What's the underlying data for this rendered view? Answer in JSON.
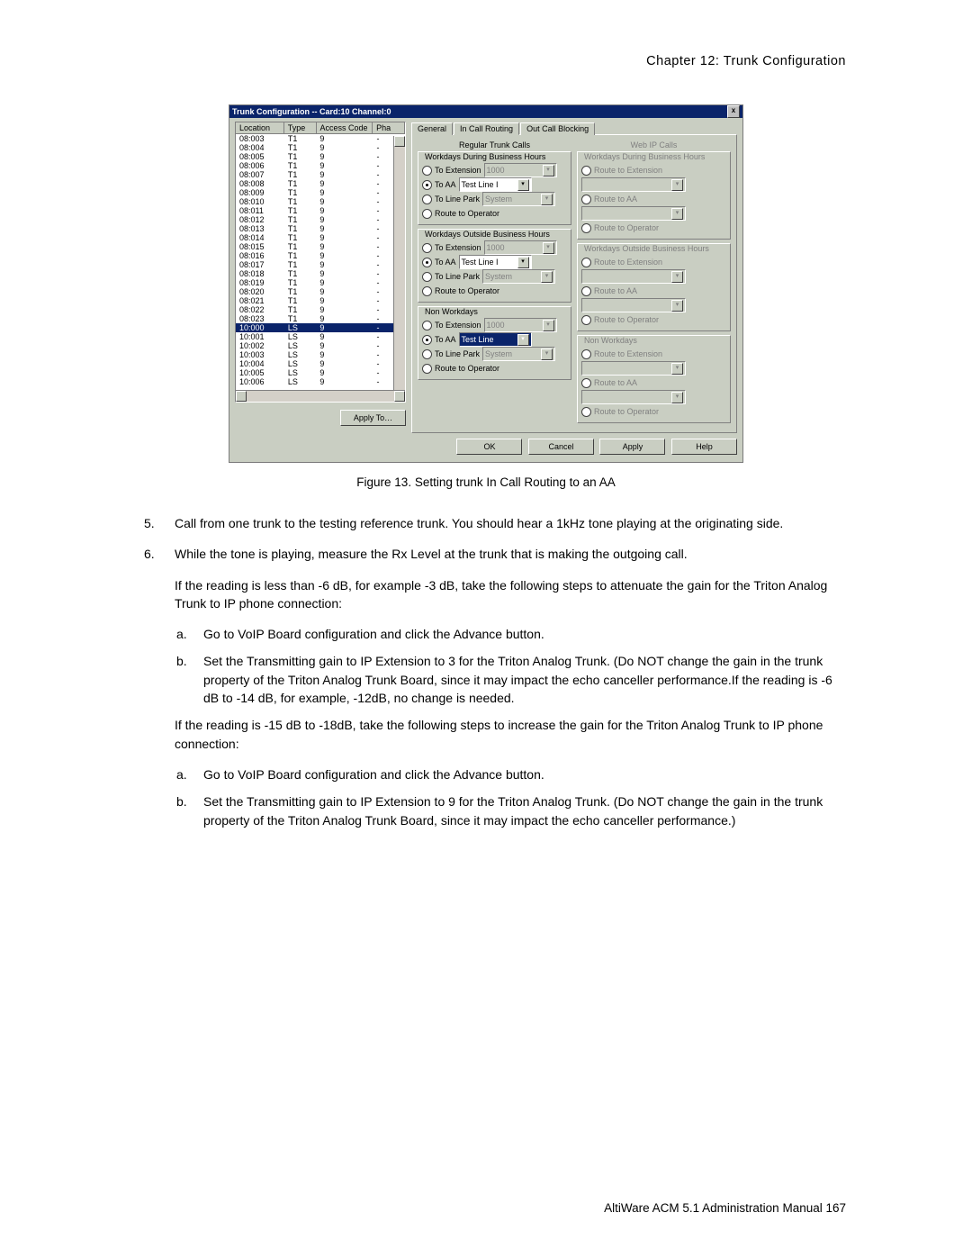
{
  "headerRight": "Chapter 12:  Trunk Configuration",
  "dialog": {
    "title": "Trunk Configuration -- Card:10 Channel:0",
    "close": "x",
    "list": {
      "cols": {
        "loc": "Location",
        "type": "Type",
        "acc": "Access Code",
        "pha": "Pha"
      },
      "rows": [
        {
          "loc": "08:003",
          "type": "T1",
          "acc": "9",
          "sel": false
        },
        {
          "loc": "08:004",
          "type": "T1",
          "acc": "9",
          "sel": false
        },
        {
          "loc": "08:005",
          "type": "T1",
          "acc": "9",
          "sel": false
        },
        {
          "loc": "08:006",
          "type": "T1",
          "acc": "9",
          "sel": false
        },
        {
          "loc": "08:007",
          "type": "T1",
          "acc": "9",
          "sel": false
        },
        {
          "loc": "08:008",
          "type": "T1",
          "acc": "9",
          "sel": false
        },
        {
          "loc": "08:009",
          "type": "T1",
          "acc": "9",
          "sel": false
        },
        {
          "loc": "08:010",
          "type": "T1",
          "acc": "9",
          "sel": false
        },
        {
          "loc": "08:011",
          "type": "T1",
          "acc": "9",
          "sel": false
        },
        {
          "loc": "08:012",
          "type": "T1",
          "acc": "9",
          "sel": false
        },
        {
          "loc": "08:013",
          "type": "T1",
          "acc": "9",
          "sel": false
        },
        {
          "loc": "08:014",
          "type": "T1",
          "acc": "9",
          "sel": false
        },
        {
          "loc": "08:015",
          "type": "T1",
          "acc": "9",
          "sel": false
        },
        {
          "loc": "08:016",
          "type": "T1",
          "acc": "9",
          "sel": false
        },
        {
          "loc": "08:017",
          "type": "T1",
          "acc": "9",
          "sel": false
        },
        {
          "loc": "08:018",
          "type": "T1",
          "acc": "9",
          "sel": false
        },
        {
          "loc": "08:019",
          "type": "T1",
          "acc": "9",
          "sel": false
        },
        {
          "loc": "08:020",
          "type": "T1",
          "acc": "9",
          "sel": false
        },
        {
          "loc": "08:021",
          "type": "T1",
          "acc": "9",
          "sel": false
        },
        {
          "loc": "08:022",
          "type": "T1",
          "acc": "9",
          "sel": false
        },
        {
          "loc": "08:023",
          "type": "T1",
          "acc": "9",
          "sel": false
        },
        {
          "loc": "10:000",
          "type": "LS",
          "acc": "9",
          "sel": true
        },
        {
          "loc": "10:001",
          "type": "LS",
          "acc": "9",
          "sel": false
        },
        {
          "loc": "10:002",
          "type": "LS",
          "acc": "9",
          "sel": false
        },
        {
          "loc": "10:003",
          "type": "LS",
          "acc": "9",
          "sel": false
        },
        {
          "loc": "10:004",
          "type": "LS",
          "acc": "9",
          "sel": false
        },
        {
          "loc": "10:005",
          "type": "LS",
          "acc": "9",
          "sel": false
        },
        {
          "loc": "10:006",
          "type": "LS",
          "acc": "9",
          "sel": false
        }
      ]
    },
    "applyTo": "Apply To…",
    "tabs": {
      "general": "General",
      "incall": "In Call Routing",
      "outcall": "Out Call Blocking"
    },
    "group_main": "Regular Trunk Calls",
    "group_ip": "Web IP Calls",
    "subgroups": {
      "wdbh": "Workdays During Business Hours",
      "wobh": "Workdays Outside Business Hours",
      "nw": "Non Workdays",
      "ip_wdbh": "Workdays During Business Hours",
      "ip_wobh": "Workdays Outside Business Hours",
      "ip_nw": "Non Workdays"
    },
    "opts": {
      "toExt": "To Extension",
      "toAA": "To AA",
      "toLP": "To Line Park",
      "toOp": "Route to Operator",
      "rExt": "Route to Extension",
      "rAA": "Route to AA",
      "rOp": "Route to Operator"
    },
    "values": {
      "ext": "1000",
      "aa": "Test Line I",
      "lp": "System",
      "nw_aa": "Test Line"
    },
    "buttons": {
      "ok": "OK",
      "cancel": "Cancel",
      "apply": "Apply",
      "help": "Help"
    }
  },
  "caption": "Figure 13.   Setting trunk In Call Routing to an AA",
  "step5_num": "5.",
  "step5": "Call from one trunk to the testing reference trunk. You should hear a 1kHz tone playing at the originating side.",
  "step6_num": "6.",
  "step6": "While the tone is playing, measure the Rx Level at the trunk that is making the outgoing call.",
  "p_less": "If the reading is less than -6 dB, for example -3 dB, take the following steps to attenuate the gain for the Triton Analog Trunk to IP phone connection:",
  "less_a_num": "a.",
  "less_a": "Go to VoIP Board configuration and click the Advance button.",
  "less_b_num": "b.",
  "less_b": "Set the Transmitting gain to IP Extension to 3 for the Triton Analog Trunk. (Do NOT change the gain in the trunk property of the Triton Analog Trunk Board, since it may impact the echo canceller performance.If the reading is -6 dB to -14 dB, for example, -12dB, no change is needed.",
  "p_more": "If the reading is -15 dB to -18dB, take the following steps to increase the gain for the Triton Analog Trunk to IP phone connection:",
  "more_a_num": "a.",
  "more_a": "Go to VoIP Board configuration and click the Advance button.",
  "more_b_num": "b.",
  "more_b": "Set the Transmitting gain to IP Extension to 9 for the Triton Analog Trunk. (Do NOT change the gain in the trunk property of the Triton Analog Trunk Board, since it may impact the echo canceller performance.)",
  "footer": "AltiWare ACM 5.1 Administration Manual   167"
}
